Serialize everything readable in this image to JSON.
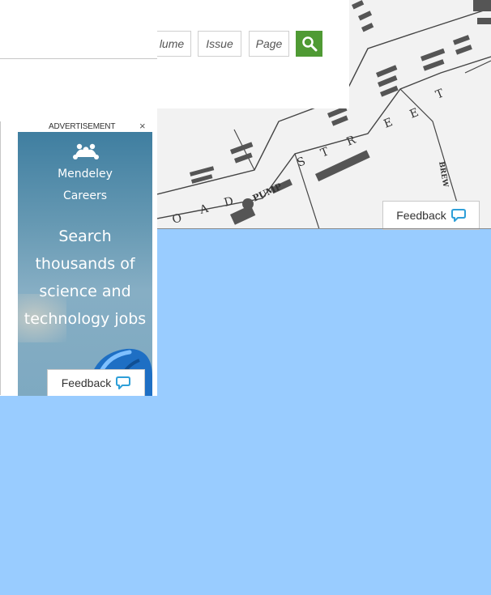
{
  "search": {
    "fields": [
      "lume",
      "Issue",
      "Page"
    ]
  },
  "ad": {
    "label": "ADVERTISEMENT",
    "close": "×",
    "brand_line1": "Mendeley",
    "brand_line2": "Careers",
    "headline_lines": [
      "Search",
      "thousands of",
      "science and",
      "technology jobs"
    ]
  },
  "map_labels": {
    "street_letters": [
      "S",
      "T",
      "R",
      "E",
      "E",
      "T"
    ],
    "road_letters": [
      "O",
      "A",
      "D"
    ],
    "pump": "PUMP",
    "brewery": "BREW"
  },
  "feedback": {
    "label": "Feedback"
  },
  "colors": {
    "background": "#99ccff",
    "search_button": "#4f9a34",
    "feedback_icon": "#2e9fd8"
  }
}
